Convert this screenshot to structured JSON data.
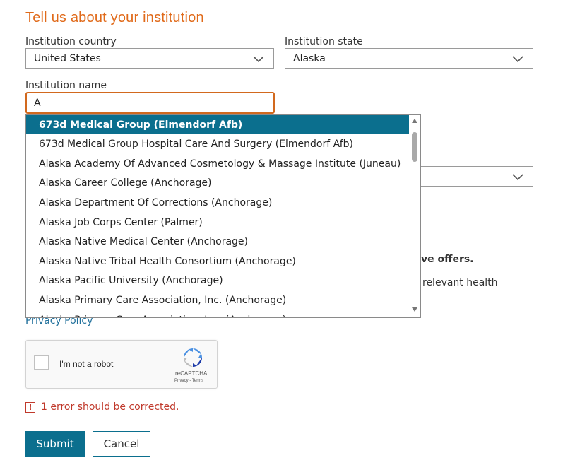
{
  "page": {
    "heading": "Tell us about your institution"
  },
  "form": {
    "country_label": "Institution country",
    "country_value": "United States",
    "state_label": "Institution state",
    "state_value": "Alaska",
    "name_label": "Institution name",
    "name_value": "A"
  },
  "dropdown": {
    "selected_index": 0,
    "options": [
      "673d Medical Group (Elmendorf Afb)",
      "673d Medical Group Hospital Care And Surgery (Elmendorf Afb)",
      "Alaska Academy Of Advanced Cosmetology & Massage Institute (Juneau)",
      "Alaska Career College (Anchorage)",
      "Alaska Department Of Corrections (Anchorage)",
      "Alaska Job Corps Center (Palmer)",
      "Alaska Native Medical Center (Anchorage)",
      "Alaska Native Tribal Health Consortium (Anchorage)",
      "Alaska Pacific University (Anchorage)",
      "Alaska Primary Care Association, Inc. (Anchorage)",
      "Alaska Primary Care Association, Inc. (Anchorage)"
    ]
  },
  "background": {
    "offers_fragment": "ve offers.",
    "health_fragment": "relevant health",
    "privacy_link": "Privacy Policy"
  },
  "captcha": {
    "label": "I'm not a robot",
    "brand": "reCAPTCHA",
    "privacy": "Privacy",
    "separator": "-",
    "terms": "Terms"
  },
  "error": {
    "icon": "!",
    "message": "1 error should be corrected."
  },
  "buttons": {
    "submit": "Submit",
    "cancel": "Cancel"
  },
  "colors": {
    "accent": "#0b6f8e",
    "heading": "#e06a1a",
    "error": "#c0392b"
  }
}
